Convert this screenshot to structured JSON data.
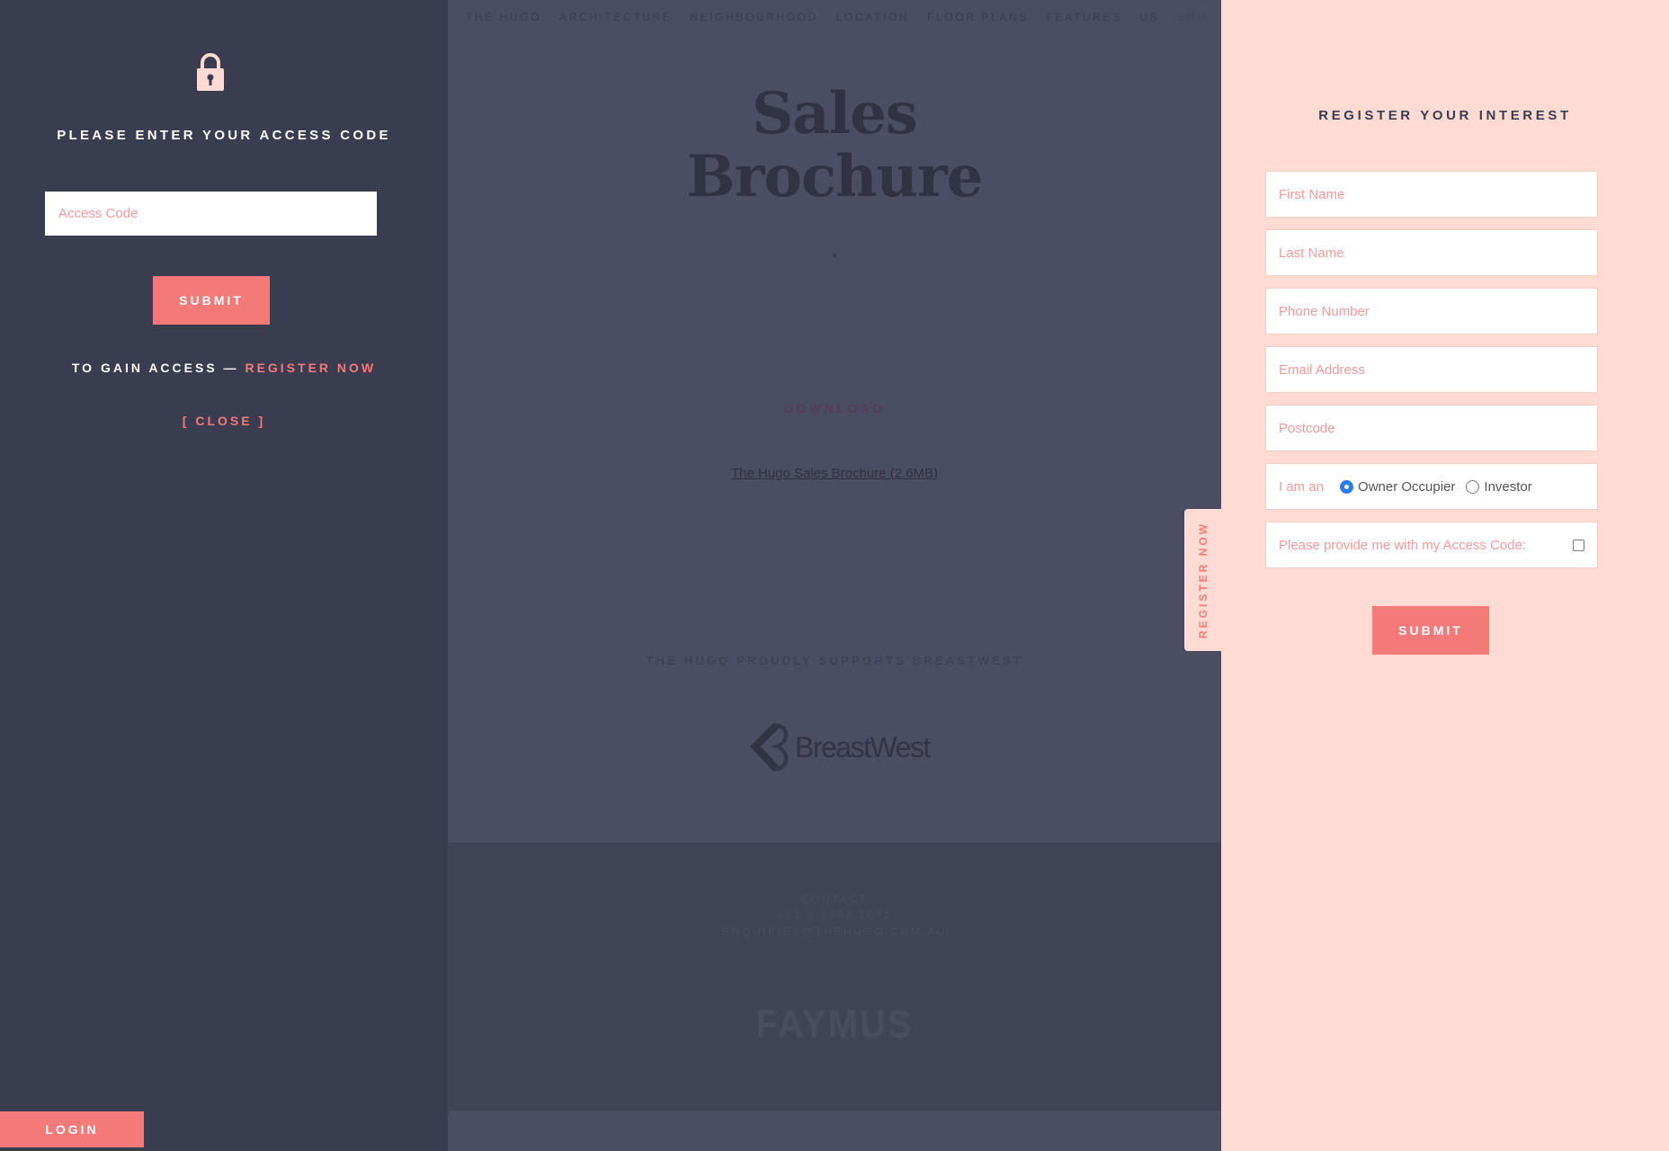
{
  "background_page": {
    "nav": [
      "THE HUGO",
      "ARCHITECTURE",
      "NEIGHBOURHOOD",
      "LOCATION",
      "FLOOR PLANS",
      "FEATURES",
      "US",
      "BROCHURE"
    ],
    "title_line1": "Sales",
    "title_line2": "Brochure",
    "download_label": "DOWNLOAD",
    "brochure_link": "The Hugo Sales Brochure (2.6MB)",
    "supports_text": "THE HUGO PROUDLY SUPPORTS BREASTWEST",
    "sponsor_logo_text": "BreastWest",
    "footer": {
      "contact_label": "CONTACT",
      "phone": "+61 8 9888 1072",
      "email": "ENQUIRIES@THEHUGO.COM.AU",
      "developer_brand": "FAYMUS"
    }
  },
  "access_panel": {
    "icon": "lock-icon",
    "heading": "PLEASE ENTER YOUR ACCESS CODE",
    "access_code_placeholder": "Access Code",
    "submit_label": "SUBMIT",
    "gain_access_prefix": "TO GAIN ACCESS — ",
    "register_now_link": "REGISTER NOW",
    "close_label": "[ CLOSE ]",
    "login_label": "LOGIN"
  },
  "register_tab_label": "REGISTER NOW",
  "register_panel": {
    "heading": "REGISTER YOUR INTEREST",
    "fields": {
      "first_name": "First Name",
      "last_name": "Last Name",
      "phone": "Phone Number",
      "email": "Email Address",
      "postcode": "Postcode"
    },
    "i_am_an_label": "I am an",
    "radio_options": [
      "Owner Occupier",
      "Investor"
    ],
    "selected_option": "Owner Occupier",
    "access_code_check_label": "Please provide me with my Access Code:",
    "access_code_checked": false,
    "submit_label": "SUBMIT"
  },
  "colors": {
    "accent": "#f47a7a",
    "left_panel_bg": "#3a3c50",
    "right_panel_bg": "#ffdbd3",
    "overlay_page_bg": "#4b4d62",
    "placeholder": "#f59a9a",
    "radio_selected": "#2b7de9"
  }
}
